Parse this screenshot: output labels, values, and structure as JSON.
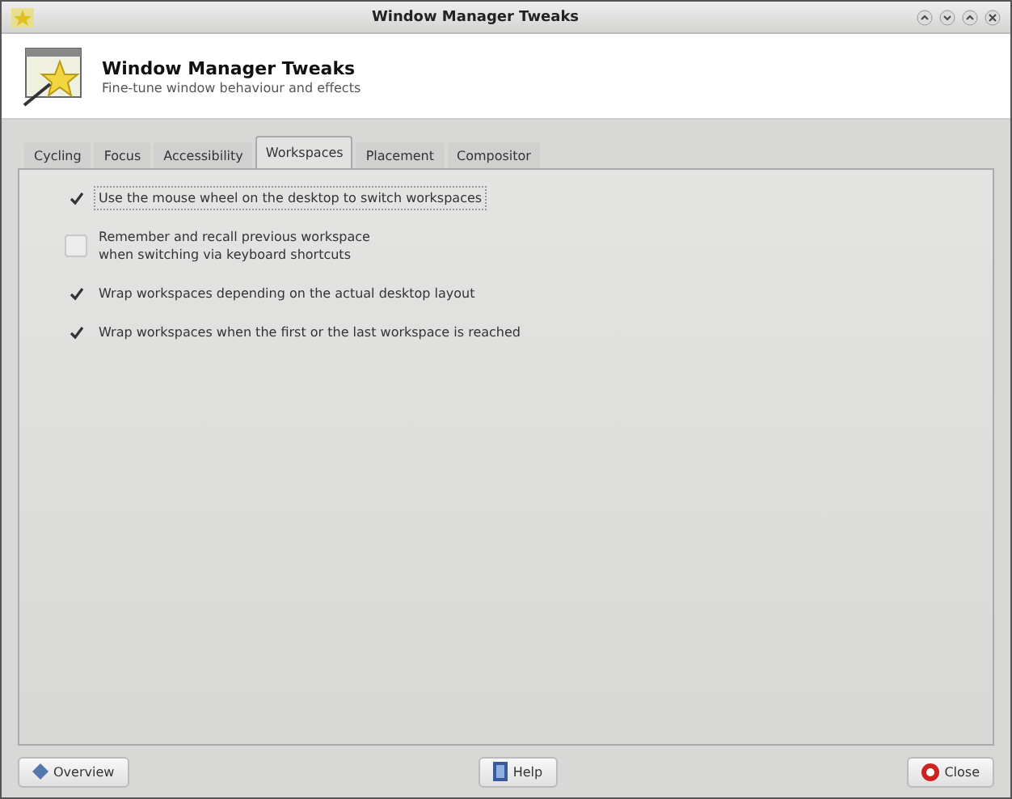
{
  "window": {
    "title": "Window Manager Tweaks"
  },
  "header": {
    "title": "Window Manager Tweaks",
    "subtitle": "Fine-tune window behaviour and effects"
  },
  "tabs": [
    {
      "label": "Cycling",
      "selected": false
    },
    {
      "label": "Focus",
      "selected": false
    },
    {
      "label": "Accessibility",
      "selected": false
    },
    {
      "label": "Workspaces",
      "selected": true
    },
    {
      "label": "Placement",
      "selected": false
    },
    {
      "label": "Compositor",
      "selected": false
    }
  ],
  "options": [
    {
      "label": "Use the mouse wheel on the desktop to switch workspaces",
      "checked": true,
      "focused": true
    },
    {
      "label": "Remember and recall previous workspace\nwhen switching via keyboard shortcuts",
      "checked": false,
      "focused": false
    },
    {
      "label": "Wrap workspaces depending on the actual desktop layout",
      "checked": true,
      "focused": false
    },
    {
      "label": "Wrap workspaces when the first or the last workspace is reached",
      "checked": true,
      "focused": false
    }
  ],
  "buttons": [
    {
      "label": "Overview",
      "kind": "overview"
    },
    {
      "label": "Help",
      "kind": "help"
    },
    {
      "label": "Close",
      "kind": "close"
    }
  ]
}
